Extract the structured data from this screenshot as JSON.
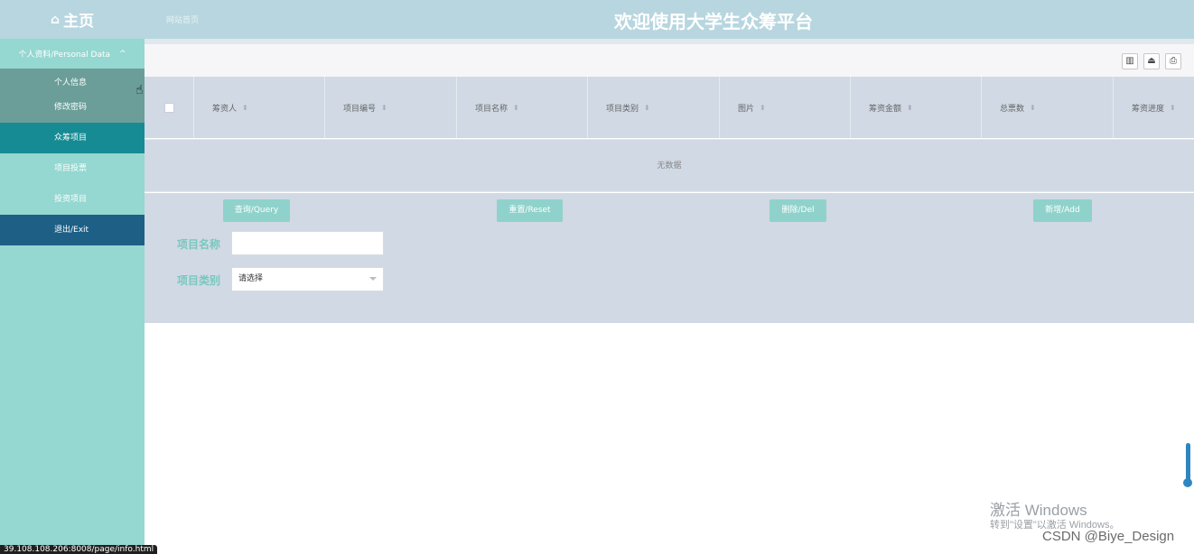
{
  "header": {
    "home_icon": "home-icon",
    "home_label": "主页",
    "site_link": "网站首页",
    "title": "欢迎使用大学生众筹平台"
  },
  "sidebar": {
    "group_label": "个人资料/Personal Data",
    "group_sub": [
      "个人信息",
      "修改密码"
    ],
    "nav": [
      "众筹项目",
      "项目投票",
      "投资项目",
      "退出/Exit"
    ]
  },
  "toolbar": {
    "icons": [
      "columns-icon",
      "export-icon",
      "print-icon"
    ]
  },
  "table": {
    "columns": [
      "筹资人",
      "项目编号",
      "项目名称",
      "项目类别",
      "图片",
      "筹资金额",
      "总票数",
      "筹资进度"
    ],
    "empty_text": "无数据"
  },
  "actions": {
    "query": "查询/Query",
    "reset": "重置/Reset",
    "delete": "删除/Del",
    "add": "新增/Add"
  },
  "form": {
    "name_label": "项目名称",
    "name_value": "",
    "category_label": "项目类别",
    "category_selected": "请选择"
  },
  "overlay": {
    "activate_title": "激活 Windows",
    "activate_sub": "转到\"设置\"以激活 Windows。",
    "watermark": "CSDN @Biye_Design",
    "status_url": "39.108.108.206:8008/page/info.html"
  },
  "colors": {
    "header_bg": "#b8d6df",
    "sidebar_bg": "#95d7d1",
    "active_nav": "#178b93",
    "exit_nav": "#1d5f85",
    "button_bg": "#8fd2cb",
    "table_bg": "#d0d9e4"
  }
}
